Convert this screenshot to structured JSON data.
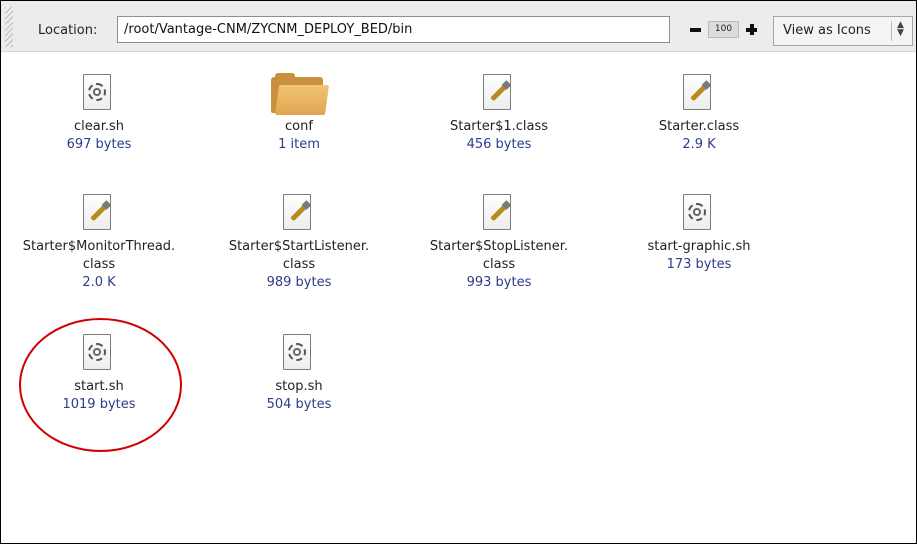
{
  "toolbar": {
    "location_label": "Location:",
    "location_value": "/root/Vantage-CNM/ZYCNM_DEPLOY_BED/bin",
    "zoom_level": "100",
    "view_mode": "View as Icons"
  },
  "files": [
    {
      "name_lines": [
        "clear.sh"
      ],
      "size": "697 bytes",
      "icon": "gear-script-icon"
    },
    {
      "name_lines": [
        "conf"
      ],
      "size": "1 item",
      "icon": "folder-icon"
    },
    {
      "name_lines": [
        "Starter$1.class"
      ],
      "size": "456 bytes",
      "icon": "java-class-icon"
    },
    {
      "name_lines": [
        "Starter.class"
      ],
      "size": "2.9 K",
      "icon": "java-class-icon"
    },
    {
      "name_lines": [
        "Starter$MonitorThread.",
        "class"
      ],
      "size": "2.0 K",
      "icon": "java-class-icon"
    },
    {
      "name_lines": [
        "Starter$StartListener.",
        "class"
      ],
      "size": "989 bytes",
      "icon": "java-class-icon"
    },
    {
      "name_lines": [
        "Starter$StopListener.",
        "class"
      ],
      "size": "993 bytes",
      "icon": "java-class-icon"
    },
    {
      "name_lines": [
        "start-graphic.sh"
      ],
      "size": "173 bytes",
      "icon": "gear-script-icon"
    },
    {
      "name_lines": [
        "start.sh"
      ],
      "size": "1019 bytes",
      "icon": "gear-script-icon"
    },
    {
      "name_lines": [
        "stop.sh"
      ],
      "size": "504 bytes",
      "icon": "gear-script-icon"
    }
  ],
  "colors": {
    "size_text": "#2e3c8c",
    "highlight_circle": "#d10000",
    "folder": "#e0a850"
  }
}
